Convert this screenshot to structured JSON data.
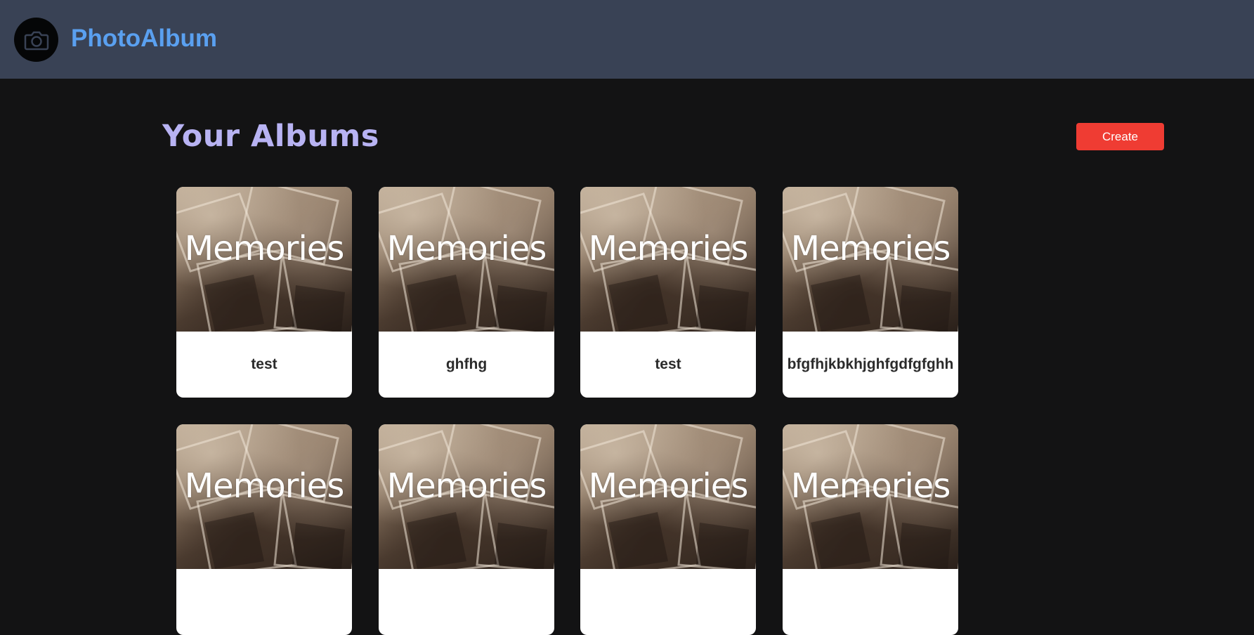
{
  "app": {
    "brand": "PhotoAlbum",
    "logo_icon": "camera-icon",
    "brand_color": "#5aa0f0"
  },
  "page": {
    "title": "Your Albums",
    "title_color": "#b8b3f3",
    "create_label": "Create",
    "create_color": "#ef3c33"
  },
  "albums": [
    {
      "cover_text": "Memories",
      "name": "test"
    },
    {
      "cover_text": "Memories",
      "name": "ghfhg"
    },
    {
      "cover_text": "Memories",
      "name": "test"
    },
    {
      "cover_text": "Memories",
      "name": "bfgfhjkbkhjghfgdfgfghh"
    },
    {
      "cover_text": "Memories",
      "name": ""
    },
    {
      "cover_text": "Memories",
      "name": ""
    },
    {
      "cover_text": "Memories",
      "name": ""
    },
    {
      "cover_text": "Memories",
      "name": ""
    }
  ]
}
